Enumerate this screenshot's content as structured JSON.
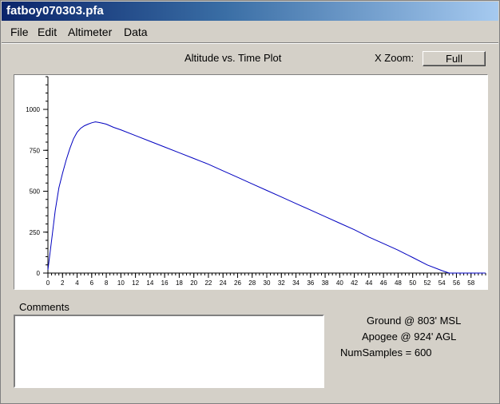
{
  "window": {
    "title": "fatboy070303.pfa"
  },
  "menu": [
    "File",
    "Edit",
    "Altimeter",
    "Data"
  ],
  "plot": {
    "title": "Altitude vs. Time Plot"
  },
  "xzoom": {
    "label": "X Zoom:",
    "button": "Full"
  },
  "comments": {
    "label": "Comments",
    "value": ""
  },
  "info": {
    "ground": "Ground @ 803' MSL",
    "apogee": "Apogee @ 924' AGL",
    "samples": "NumSamples = 600"
  },
  "colors": {
    "line": "#0000c0",
    "titlebar_start": "#0a246a",
    "titlebar_end": "#a6caf0"
  },
  "chart_data": {
    "type": "line",
    "title": "Altitude vs. Time Plot",
    "xlabel": "",
    "ylabel": "",
    "xlim": [
      0,
      60
    ],
    "ylim": [
      0,
      1200
    ],
    "xticks": [
      0,
      2,
      4,
      6,
      8,
      10,
      12,
      14,
      16,
      18,
      20,
      22,
      24,
      26,
      28,
      30,
      32,
      34,
      36,
      38,
      40,
      42,
      44,
      46,
      48,
      50,
      52,
      54,
      56,
      58
    ],
    "yticks": [
      0,
      250,
      500,
      750,
      1000
    ],
    "grid": false,
    "series": [
      {
        "x": [
          0,
          0.5,
          1,
          1.5,
          2,
          2.5,
          3,
          3.5,
          4,
          4.5,
          5,
          5.5,
          6,
          6.5,
          7,
          7.5,
          8,
          9,
          10,
          12,
          14,
          16,
          18,
          20,
          22,
          24,
          26,
          28,
          30,
          32,
          34,
          36,
          38,
          40,
          42,
          44,
          46,
          48,
          50,
          52,
          54,
          55,
          56,
          58,
          60
        ],
        "y": [
          20,
          200,
          380,
          520,
          610,
          690,
          760,
          820,
          860,
          885,
          900,
          910,
          918,
          924,
          920,
          915,
          910,
          890,
          875,
          840,
          805,
          770,
          735,
          700,
          665,
          625,
          585,
          545,
          505,
          465,
          425,
          385,
          345,
          305,
          265,
          220,
          180,
          140,
          95,
          50,
          15,
          0,
          0,
          0,
          0
        ]
      }
    ]
  }
}
